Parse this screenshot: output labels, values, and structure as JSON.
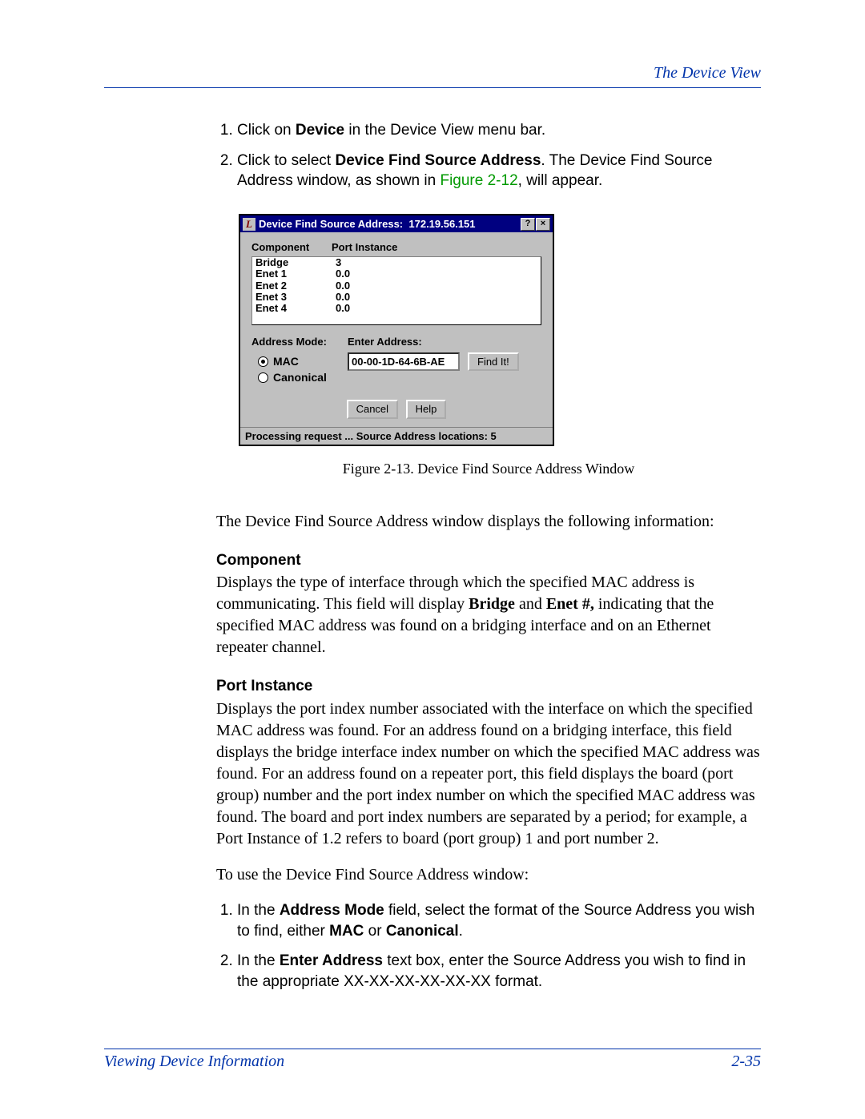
{
  "header": {
    "section_title": "The Device View"
  },
  "steps_a": [
    {
      "pre": "Click on ",
      "bold": "Device",
      "post": " in the Device View menu bar."
    },
    {
      "pre": "Click to select ",
      "bold": "Device Find Source Address",
      "post": ". The Device Find Source Address window, as shown in ",
      "link": "Figure 2-12",
      "tail": ", will appear."
    }
  ],
  "window": {
    "title_prefix": "Device Find Source Address:",
    "title_ip": "172.19.56.151",
    "help_btn": "?",
    "close_btn": "×",
    "headers": {
      "component": "Component",
      "port_instance": "Port Instance"
    },
    "rows": [
      {
        "component": "Bridge",
        "port": "3"
      },
      {
        "component": "Enet 1",
        "port": "0.0"
      },
      {
        "component": "Enet 2",
        "port": "0.0"
      },
      {
        "component": "Enet 3",
        "port": "0.0"
      },
      {
        "component": "Enet 4",
        "port": "0.0"
      }
    ],
    "address_mode_label": "Address Mode:",
    "enter_address_label": "Enter Address:",
    "radios": {
      "mac": "MAC",
      "canonical": "Canonical"
    },
    "address_value": "00-00-1D-64-6B-AE",
    "find_btn": "Find It!",
    "cancel_btn": "Cancel",
    "help_btn2": "Help",
    "status": "Processing request ... Source Address locations: 5"
  },
  "caption": "Figure 2-13. Device Find Source Address Window",
  "intro_para": "The Device Find Source Address window displays the following information:",
  "defs": {
    "component": {
      "title": "Component",
      "body_pre": "Displays the type of interface through which the specified MAC address is communicating. This field will display ",
      "b1": "Bridge",
      "mid": " and ",
      "b2": "Enet #,",
      "body_post": " indicating that the specified MAC address was found on a bridging interface and on an Ethernet repeater channel."
    },
    "port_instance": {
      "title": "Port Instance",
      "body": "Displays the port index number associated with the interface on which the specified MAC address was found. For an address found on a bridging interface, this field displays the bridge interface index number on which the specified MAC address was found. For an address found on a repeater port, this field displays the board (port group) number and the port index number on which the specified MAC address was found. The board and port index numbers are separated by a period; for example, a Port Instance of 1.2 refers to board (port group) 1 and port number 2."
    }
  },
  "use_para": "To use the Device Find Source Address window:",
  "steps_b": [
    {
      "pre": "In the ",
      "b1": "Address Mode",
      "mid": " field, select the format of the Source Address you wish to find, either ",
      "b2": "MAC",
      "mid2": " or ",
      "b3": "Canonical",
      "post": "."
    },
    {
      "pre": "In the ",
      "b1": "Enter Address",
      "post": " text box, enter the Source Address you wish to find in the appropriate XX-XX-XX-XX-XX-XX format."
    }
  ],
  "footer": {
    "left": "Viewing Device Information",
    "right": "2-35"
  }
}
